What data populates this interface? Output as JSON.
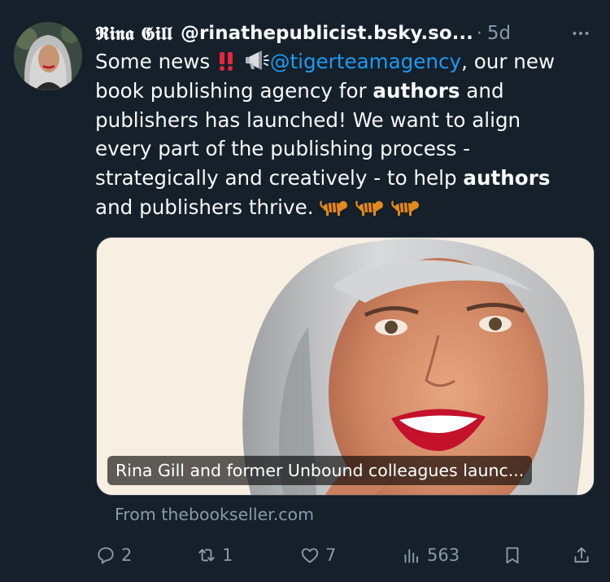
{
  "tweet": {
    "author": {
      "display_name": "𝕽𝖎𝖓𝖆 𝕲𝖎𝖑𝖑",
      "handle": "@rinathepublicist.bsky.so...",
      "time_ago": "5d"
    },
    "separator": "·",
    "text": {
      "l1_pre": "Some news",
      "l1_mention": "@tigerteamagency",
      "l1_post": ", our new",
      "l2_pre": "book publishing agency for ",
      "l2_bold": "authors",
      "l2_post": " and",
      "l3": "publishers has launched! We want to align",
      "l4": "every part of the publishing process -",
      "l5_pre": "strategically and creatively - to help ",
      "l5_bold": "authors",
      "l6": "and publishers thrive."
    },
    "link_card": {
      "caption": "Rina Gill and former Unbound colleagues launc...",
      "source": "From thebookseller.com"
    },
    "actions": {
      "replies": "2",
      "reposts": "1",
      "likes": "7",
      "views": "563"
    },
    "icons": {
      "more": "more-dots-icon",
      "reply": "reply-bubble-icon",
      "repost": "repost-arrows-icon",
      "like": "heart-icon",
      "views": "analytics-bars-icon",
      "bookmark": "bookmark-icon",
      "share": "share-upload-icon",
      "double_exclamation": "double-exclamation-emoji",
      "megaphone": "megaphone-emoji",
      "tiger": "tiger-emoji"
    },
    "colors": {
      "background": "#15202b",
      "text": "#f7f9f9",
      "muted": "#8b98a5",
      "link": "#1d9bf0",
      "border": "#38444d"
    }
  }
}
